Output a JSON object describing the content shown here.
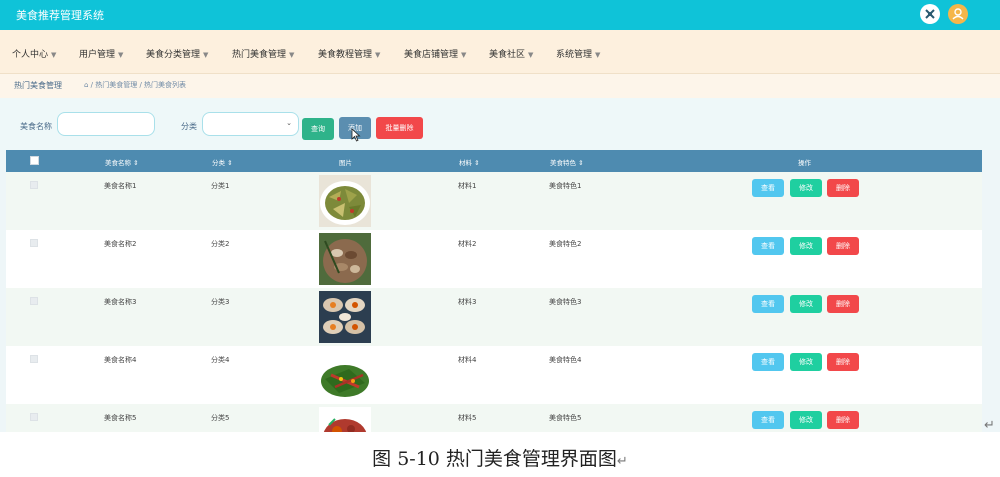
{
  "app": {
    "title": "美食推荐管理系统"
  },
  "header_icons": [
    "fullscreen-icon",
    "user-avatar-icon"
  ],
  "nav": [
    {
      "label": "个人中心"
    },
    {
      "label": "用户管理"
    },
    {
      "label": "美食分类管理"
    },
    {
      "label": "热门美食管理"
    },
    {
      "label": "美食教程管理"
    },
    {
      "label": "美食店铺管理"
    },
    {
      "label": "美食社区"
    },
    {
      "label": "系统管理"
    }
  ],
  "breadcrumb": {
    "title": "热门美食管理",
    "path": "⌂ / 热门美食管理 / 热门美食列表"
  },
  "search": {
    "name_label": "美食名称",
    "name_value": "",
    "category_label": "分类",
    "category_value": "",
    "search_button": "查询",
    "add_button": "添加",
    "batch_delete_button": "批量删除"
  },
  "table": {
    "columns": [
      "美食名称 ⇕",
      "分类 ⇕",
      "图片",
      "材料 ⇕",
      "美食特色 ⇕",
      "操作"
    ],
    "rows": [
      {
        "name": "美食名称1",
        "category": "分类1",
        "material": "材料1",
        "feature": "美食特色1"
      },
      {
        "name": "美食名称2",
        "category": "分类2",
        "material": "材料2",
        "feature": "美食特色2"
      },
      {
        "name": "美食名称3",
        "category": "分类3",
        "material": "材料3",
        "feature": "美食特色3"
      },
      {
        "name": "美食名称4",
        "category": "分类4",
        "material": "材料4",
        "feature": "美食特色4"
      },
      {
        "name": "美食名称5",
        "category": "分类5",
        "material": "材料5",
        "feature": "美食特色5"
      }
    ],
    "actions": {
      "view": "查看",
      "edit": "修改",
      "delete": "删除"
    }
  },
  "caption": "图 5-10 热门美食管理界面图",
  "return_mark": "↵",
  "colors": {
    "topbar": "#0fc3d8",
    "nav_bg": "#fdf0de",
    "table_header": "#4e8bb0",
    "view": "#52c7ef",
    "edit": "#1fcfa0",
    "delete": "#f2484a"
  }
}
